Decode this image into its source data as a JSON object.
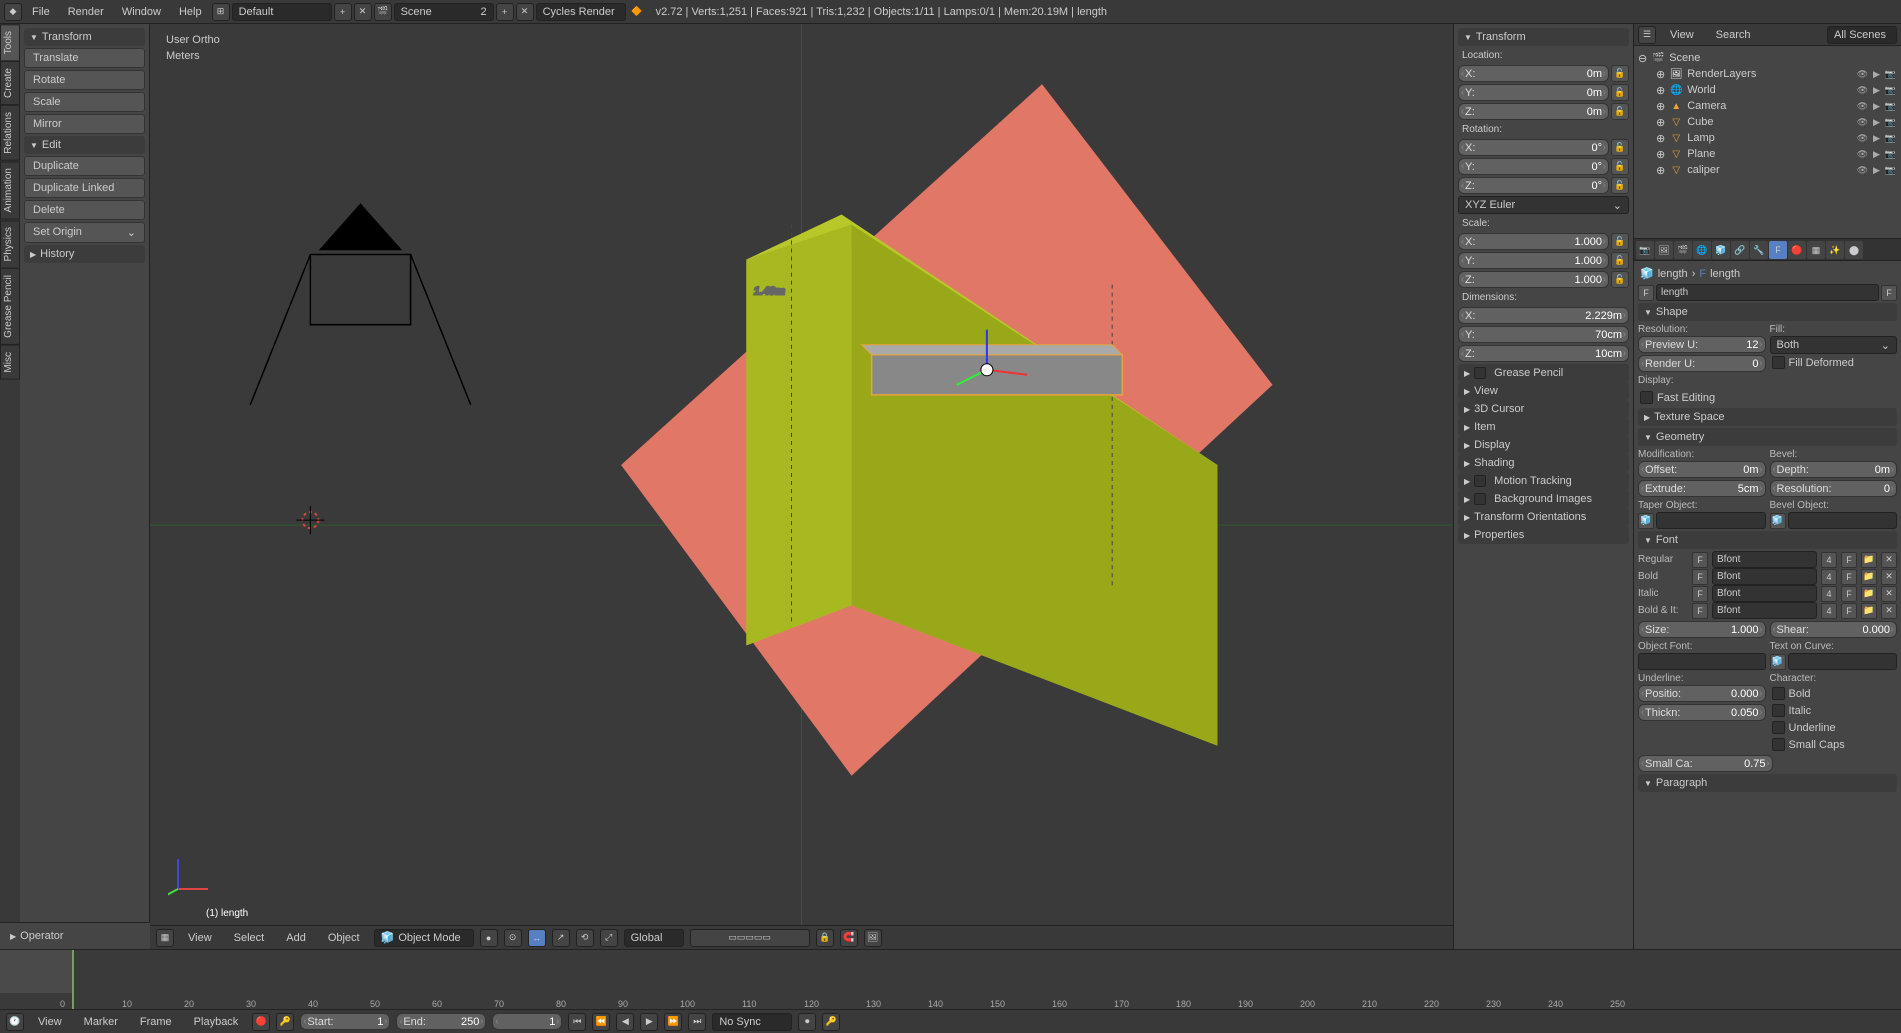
{
  "top_menu": {
    "file": "File",
    "render": "Render",
    "window": "Window",
    "help": "Help"
  },
  "layout_selector": "Default",
  "scene_selector": "Scene",
  "scene_count": "2",
  "renderer": "Cycles Render",
  "stats": "v2.72 | Verts:1,251 | Faces:921 | Tris:1,232 | Objects:1/11 | Lamps:0/1 | Mem:20.19M | length",
  "vtabs": [
    "Tools",
    "Create",
    "Relations",
    "Animation",
    "Physics",
    "Grease Pencil",
    "Misc"
  ],
  "tool_panel": {
    "transform": {
      "header": "Transform",
      "translate": "Translate",
      "rotate": "Rotate",
      "scale": "Scale",
      "mirror": "Mirror"
    },
    "edit": {
      "header": "Edit",
      "duplicate": "Duplicate",
      "duplicate_linked": "Duplicate Linked",
      "delete": "Delete",
      "set_origin": "Set Origin"
    },
    "history": {
      "header": "History"
    }
  },
  "operator_panel": "Operator",
  "viewport": {
    "view": "User Ortho",
    "units": "Meters",
    "text3d": "1.49m",
    "selection": "(1) length"
  },
  "vp_menu": {
    "view": "View",
    "select": "Select",
    "add": "Add",
    "object": "Object",
    "mode": "Object Mode",
    "orient": "Global"
  },
  "nprop": {
    "header": "Transform",
    "location": {
      "label": "Location:",
      "x": {
        "l": "X:",
        "v": "0m"
      },
      "y": {
        "l": "Y:",
        "v": "0m"
      },
      "z": {
        "l": "Z:",
        "v": "0m"
      }
    },
    "rotation": {
      "label": "Rotation:",
      "x": {
        "l": "X:",
        "v": "0°"
      },
      "y": {
        "l": "Y:",
        "v": "0°"
      },
      "z": {
        "l": "Z:",
        "v": "0°"
      },
      "mode": "XYZ Euler"
    },
    "scale": {
      "label": "Scale:",
      "x": {
        "l": "X:",
        "v": "1.000"
      },
      "y": {
        "l": "Y:",
        "v": "1.000"
      },
      "z": {
        "l": "Z:",
        "v": "1.000"
      }
    },
    "dimensions": {
      "label": "Dimensions:",
      "x": {
        "l": "X:",
        "v": "2.229m"
      },
      "y": {
        "l": "Y:",
        "v": "70cm"
      },
      "z": {
        "l": "Z:",
        "v": "10cm"
      }
    },
    "panels": [
      "Grease Pencil",
      "View",
      "3D Cursor",
      "Item",
      "Display",
      "Shading",
      "Motion Tracking",
      "Background Images",
      "Transform Orientations",
      "Properties"
    ]
  },
  "outliner": {
    "menu": {
      "view": "View",
      "search": "Search",
      "filter": "All Scenes"
    },
    "scene": "Scene",
    "items": [
      {
        "name": "RenderLayers",
        "icon": "🖼",
        "color": "#fff"
      },
      {
        "name": "World",
        "icon": "🌐",
        "color": "#fff"
      },
      {
        "name": "Camera",
        "icon": "▲",
        "color": "#e8a33d"
      },
      {
        "name": "Cube",
        "icon": "▽",
        "color": "#e8a33d"
      },
      {
        "name": "Lamp",
        "icon": "▽",
        "color": "#e8a33d"
      },
      {
        "name": "Plane",
        "icon": "▽",
        "color": "#e8a33d"
      },
      {
        "name": "caliper",
        "icon": "▽",
        "color": "#e8a33d"
      }
    ]
  },
  "props": {
    "breadcrumb": {
      "obj": "length",
      "data": "length"
    },
    "name_field": "length",
    "shape": {
      "header": "Shape",
      "resolution": "Resolution:",
      "preview_u": {
        "l": "Preview U:",
        "v": "12"
      },
      "render_u": {
        "l": "Render U:",
        "v": "0"
      },
      "fill": "Fill:",
      "fill_mode": "Both",
      "fill_deformed": "Fill Deformed",
      "display": "Display:",
      "fast_edit": "Fast Editing"
    },
    "texture_space": "Texture Space",
    "geometry": {
      "header": "Geometry",
      "modification": "Modification:",
      "offset": {
        "l": "Offset:",
        "v": "0m"
      },
      "extrude": {
        "l": "Extrude:",
        "v": "5cm"
      },
      "bevel": "Bevel:",
      "depth": {
        "l": "Depth:",
        "v": "0m"
      },
      "resolution": {
        "l": "Resolution:",
        "v": "0"
      },
      "taper": "Taper Object:",
      "bevel_obj": "Bevel Object:"
    },
    "font": {
      "header": "Font",
      "regular": "Regular",
      "bold": "Bold",
      "italic": "Italic",
      "bold_it": "Bold & It:",
      "bfont": "Bfont",
      "size": {
        "l": "Size:",
        "v": "1.000"
      },
      "shear": {
        "l": "Shear:",
        "v": "0.000"
      },
      "obj_font": "Object Font:",
      "text_curve": "Text on Curve:",
      "underline": "Underline:",
      "position": {
        "l": "Positio:",
        "v": "0.000"
      },
      "thickness": {
        "l": "Thickn:",
        "v": "0.050"
      },
      "character": "Character:",
      "cb_bold": "Bold",
      "cb_italic": "Italic",
      "cb_underline": "Underline",
      "cb_smallcaps": "Small Caps",
      "small_ca": {
        "l": "Small Ca:",
        "v": "0.75"
      }
    },
    "paragraph": "Paragraph"
  },
  "timeline": {
    "menu": {
      "view": "View",
      "marker": "Marker",
      "frame": "Frame",
      "playback": "Playback"
    },
    "start": {
      "l": "Start:",
      "v": "1"
    },
    "end": {
      "l": "End:",
      "v": "250"
    },
    "current": {
      "l": "",
      "v": "1"
    },
    "sync": "No Sync",
    "ticks": [
      "0",
      "10",
      "20",
      "30",
      "40",
      "50",
      "60",
      "70",
      "80",
      "90",
      "100",
      "110",
      "120",
      "130",
      "140",
      "150",
      "160",
      "170",
      "180",
      "190",
      "200",
      "210",
      "220",
      "230",
      "240",
      "250"
    ]
  }
}
